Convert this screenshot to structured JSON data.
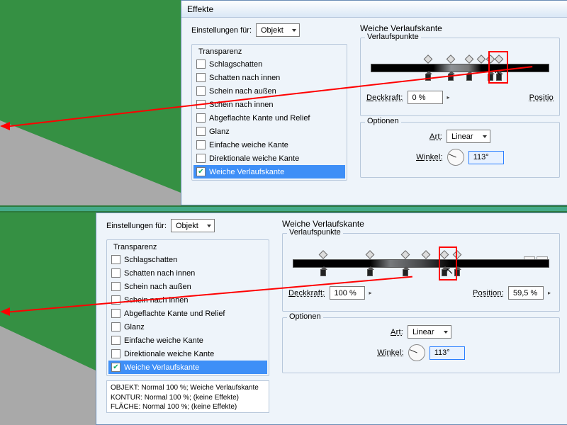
{
  "top": {
    "dialog_title": "Effekte",
    "settings_for_label": "Einstellungen für:",
    "settings_for_value": "Objekt",
    "fx_group": "Transparenz",
    "fx_items": [
      {
        "label": "Schlagschatten",
        "checked": false
      },
      {
        "label": "Schatten nach innen",
        "checked": false
      },
      {
        "label": "Schein nach außen",
        "checked": false
      },
      {
        "label": "Schein nach innen",
        "checked": false
      },
      {
        "label": "Abgeflachte Kante und Relief",
        "checked": false
      },
      {
        "label": "Glanz",
        "checked": false
      },
      {
        "label": "Einfache weiche Kante",
        "checked": false
      },
      {
        "label": "Direktionale weiche Kante",
        "checked": false
      },
      {
        "label": "Weiche Verlaufskante",
        "checked": true
      }
    ],
    "panel_title": "Weiche Verlaufskante",
    "stops_title": "Verlaufspunkte",
    "opacity_label": "Deckkraft:",
    "opacity_value": "0 %",
    "position_label": "Positio",
    "options_title": "Optionen",
    "type_label": "Art:",
    "type_value": "Linear",
    "angle_label": "Winkel:",
    "angle_value": "113°"
  },
  "bot": {
    "settings_for_label": "Einstellungen für:",
    "settings_for_value": "Objekt",
    "fx_group": "Transparenz",
    "fx_items": [
      {
        "label": "Schlagschatten",
        "checked": false
      },
      {
        "label": "Schatten nach innen",
        "checked": false
      },
      {
        "label": "Schein nach außen",
        "checked": false
      },
      {
        "label": "Schein nach innen",
        "checked": false
      },
      {
        "label": "Abgeflachte Kante und Relief",
        "checked": false
      },
      {
        "label": "Glanz",
        "checked": false
      },
      {
        "label": "Einfache weiche Kante",
        "checked": false
      },
      {
        "label": "Direktionale weiche Kante",
        "checked": false
      },
      {
        "label": "Weiche Verlaufskante",
        "checked": true
      }
    ],
    "panel_title": "Weiche Verlaufskante",
    "stops_title": "Verlaufspunkte",
    "opacity_label": "Deckkraft:",
    "opacity_value": "100 %",
    "position_label": "Position:",
    "position_value": "59,5 %",
    "options_title": "Optionen",
    "type_label": "Art:",
    "type_value": "Linear",
    "angle_label": "Winkel:",
    "angle_value": "113°",
    "summary_lines": [
      "OBJEKT: Normal 100 %; Weiche Verlaufskante",
      "KONTUR: Normal 100 %; (keine Effekte)",
      "FLÄCHE: Normal 100 %; (keine Effekte)"
    ]
  }
}
